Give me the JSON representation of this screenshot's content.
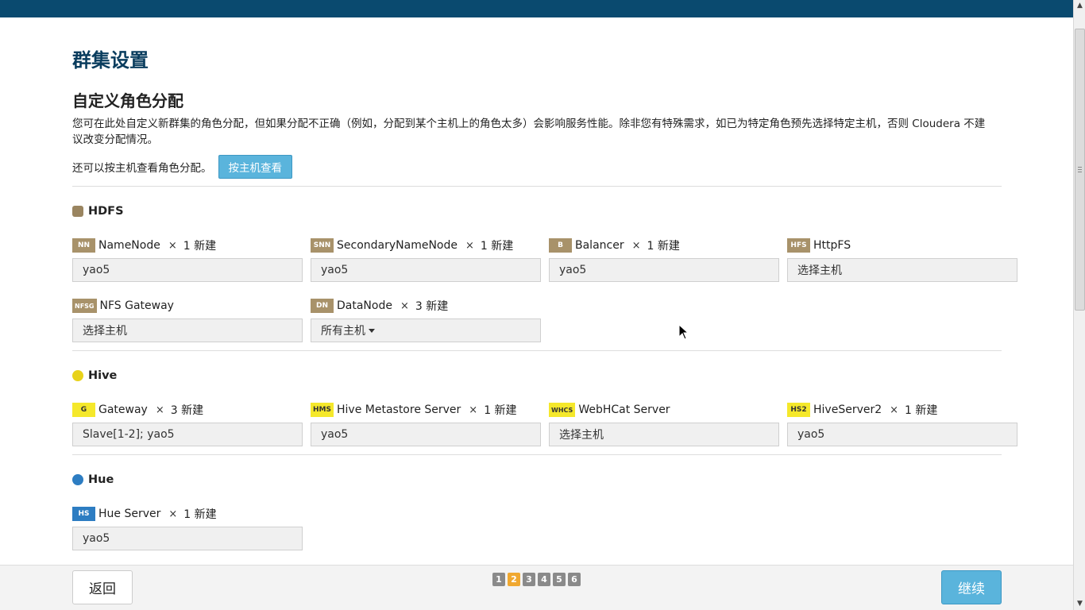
{
  "page": {
    "title": "群集设置",
    "subtitle": "自定义角色分配",
    "description": "您可在此处自定义新群集的角色分配，但如果分配不正确（例如，分配到某个主机上的角色太多）会影响服务性能。除非您有特殊需求，如已为特定角色预先选择特定主机，否则 Cloudera 不建议改变分配情况。",
    "host_view_text": "还可以按主机查看角色分配。",
    "host_view_button": "按主机查看"
  },
  "services": {
    "hdfs": {
      "name": "HDFS",
      "roles": {
        "namenode": {
          "badge": "NN",
          "name": "NameNode",
          "times": "×",
          "count": "1 新建",
          "value": "yao5"
        },
        "snn": {
          "badge": "SNN",
          "name": "SecondaryNameNode",
          "times": "×",
          "count": "1 新建",
          "value": "yao5"
        },
        "balancer": {
          "badge": "B",
          "name": "Balancer",
          "times": "×",
          "count": "1 新建",
          "value": "yao5"
        },
        "httpfs": {
          "badge": "HFS",
          "name": "HttpFS",
          "value": "选择主机"
        },
        "nfsg": {
          "badge": "NFSG",
          "name": "NFS Gateway",
          "value": "选择主机"
        },
        "datanode": {
          "badge": "DN",
          "name": "DataNode",
          "times": "×",
          "count": "3 新建",
          "value": "所有主机"
        }
      }
    },
    "hive": {
      "name": "Hive",
      "roles": {
        "gateway": {
          "badge": "G",
          "name": "Gateway",
          "times": "×",
          "count": "3 新建",
          "value": "Slave[1-2]; yao5"
        },
        "hms": {
          "badge": "HMS",
          "name": "Hive Metastore Server",
          "times": "×",
          "count": "1 新建",
          "value": "yao5"
        },
        "whcs": {
          "badge": "WHCS",
          "name": "WebHCat Server",
          "value": "选择主机"
        },
        "hs2": {
          "badge": "HS2",
          "name": "HiveServer2",
          "times": "×",
          "count": "1 新建",
          "value": "yao5"
        }
      }
    },
    "hue": {
      "name": "Hue",
      "roles": {
        "hs": {
          "badge": "HS",
          "name": "Hue Server",
          "times": "×",
          "count": "1 新建",
          "value": "yao5"
        }
      }
    }
  },
  "footer": {
    "back": "返回",
    "next": "继续",
    "pages": [
      "1",
      "2",
      "3",
      "4",
      "5",
      "6"
    ],
    "active_page": "2"
  },
  "colors": {
    "topbar": "#0a4a6f",
    "primary_button": "#5ab4dc",
    "hdfs_badge": "#a8926a",
    "hive_badge": "#f5e82b",
    "hue_badge": "#2d7dc2",
    "active_page": "#f0a830"
  }
}
